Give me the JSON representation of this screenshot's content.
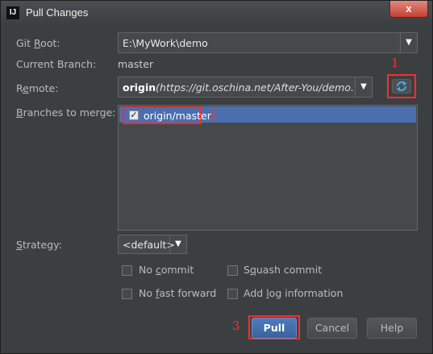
{
  "window": {
    "title": "Pull Changes",
    "app_icon_text": "IJ",
    "close_glyph": "x"
  },
  "labels": {
    "git_root_pre": "Git ",
    "git_root_mn": "R",
    "git_root_post": "oot:",
    "current_branch": "Current Branch:",
    "remote_pre": "R",
    "remote_mn": "e",
    "remote_post": "mote:",
    "branches_mn": "B",
    "branches_post": "ranches to merge:",
    "strategy_mn": "S",
    "strategy_post": "trategy:"
  },
  "git_root": {
    "value": "E:\\MyWork\\demo"
  },
  "current_branch_value": "master",
  "remote": {
    "name": "origin",
    "url": "(https://git.oschina.net/After-You/demo.git)"
  },
  "branches": [
    {
      "label": "origin/master",
      "checked": true
    }
  ],
  "strategy": {
    "value": "<default>"
  },
  "options": {
    "no_commit_pre": "No ",
    "no_commit_mn": "c",
    "no_commit_post": "ommit",
    "squash_pre": "S",
    "squash_mn": "q",
    "squash_post": "uash commit",
    "no_ff_pre": "No ",
    "no_ff_mn": "f",
    "no_ff_post": "ast forward",
    "add_log_pre": "Add ",
    "add_log_mn": "l",
    "add_log_post": "og information"
  },
  "buttons": {
    "pull": "Pull",
    "cancel": "Cancel",
    "help": "Help"
  },
  "annotations": {
    "a1": "1",
    "a2": "2",
    "a3": "3"
  },
  "icons": {
    "dropdown": "chevron-down-icon",
    "refresh": "refresh-icon",
    "check": "checkmark-icon"
  },
  "colors": {
    "selection": "#4b6eaf",
    "annotation": "#ff2b2b",
    "primary_button": "#3a629e"
  }
}
